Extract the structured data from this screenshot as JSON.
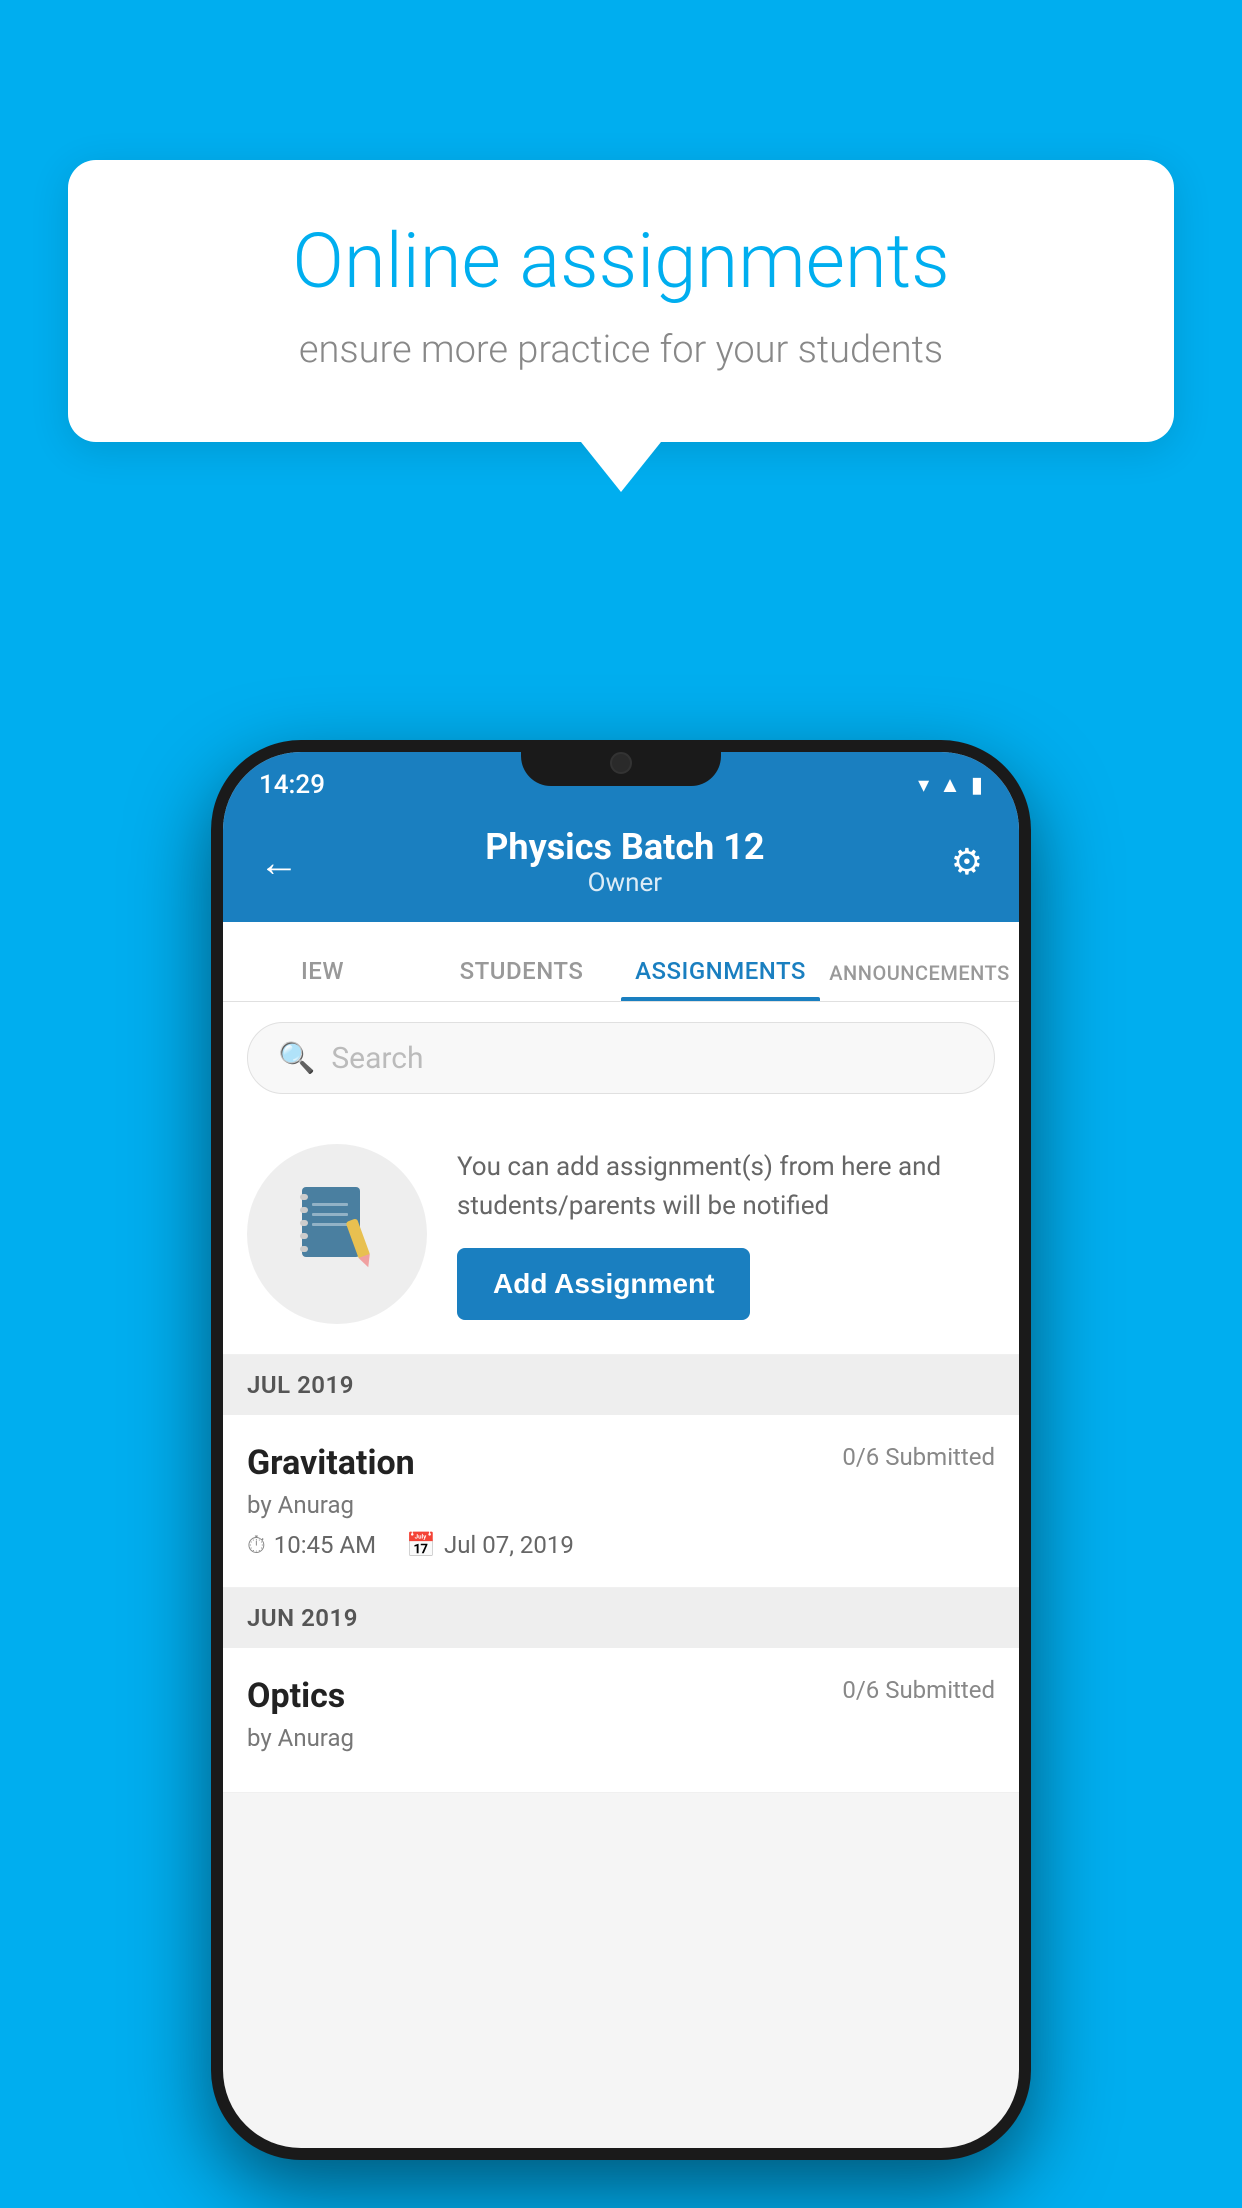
{
  "background_color": "#00AEEF",
  "speech_bubble": {
    "title": "Online assignments",
    "subtitle": "ensure more practice for your students"
  },
  "phone": {
    "status_bar": {
      "time": "14:29",
      "icons": [
        "wifi",
        "signal",
        "battery"
      ]
    },
    "header": {
      "title": "Physics Batch 12",
      "subtitle": "Owner",
      "back_label": "←",
      "settings_label": "⚙"
    },
    "tabs": [
      {
        "label": "IEW",
        "active": false
      },
      {
        "label": "STUDENTS",
        "active": false
      },
      {
        "label": "ASSIGNMENTS",
        "active": true
      },
      {
        "label": "ANNOUNCEMENTS",
        "active": false
      }
    ],
    "search": {
      "placeholder": "Search"
    },
    "promo": {
      "text": "You can add assignment(s) from here and students/parents will be notified",
      "button_label": "Add Assignment"
    },
    "sections": [
      {
        "header": "JUL 2019",
        "assignments": [
          {
            "title": "Gravitation",
            "submitted": "0/6 Submitted",
            "by": "by Anurag",
            "time": "10:45 AM",
            "date": "Jul 07, 2019"
          }
        ]
      },
      {
        "header": "JUN 2019",
        "assignments": [
          {
            "title": "Optics",
            "submitted": "0/6 Submitted",
            "by": "by Anurag",
            "time": "",
            "date": ""
          }
        ]
      }
    ]
  }
}
